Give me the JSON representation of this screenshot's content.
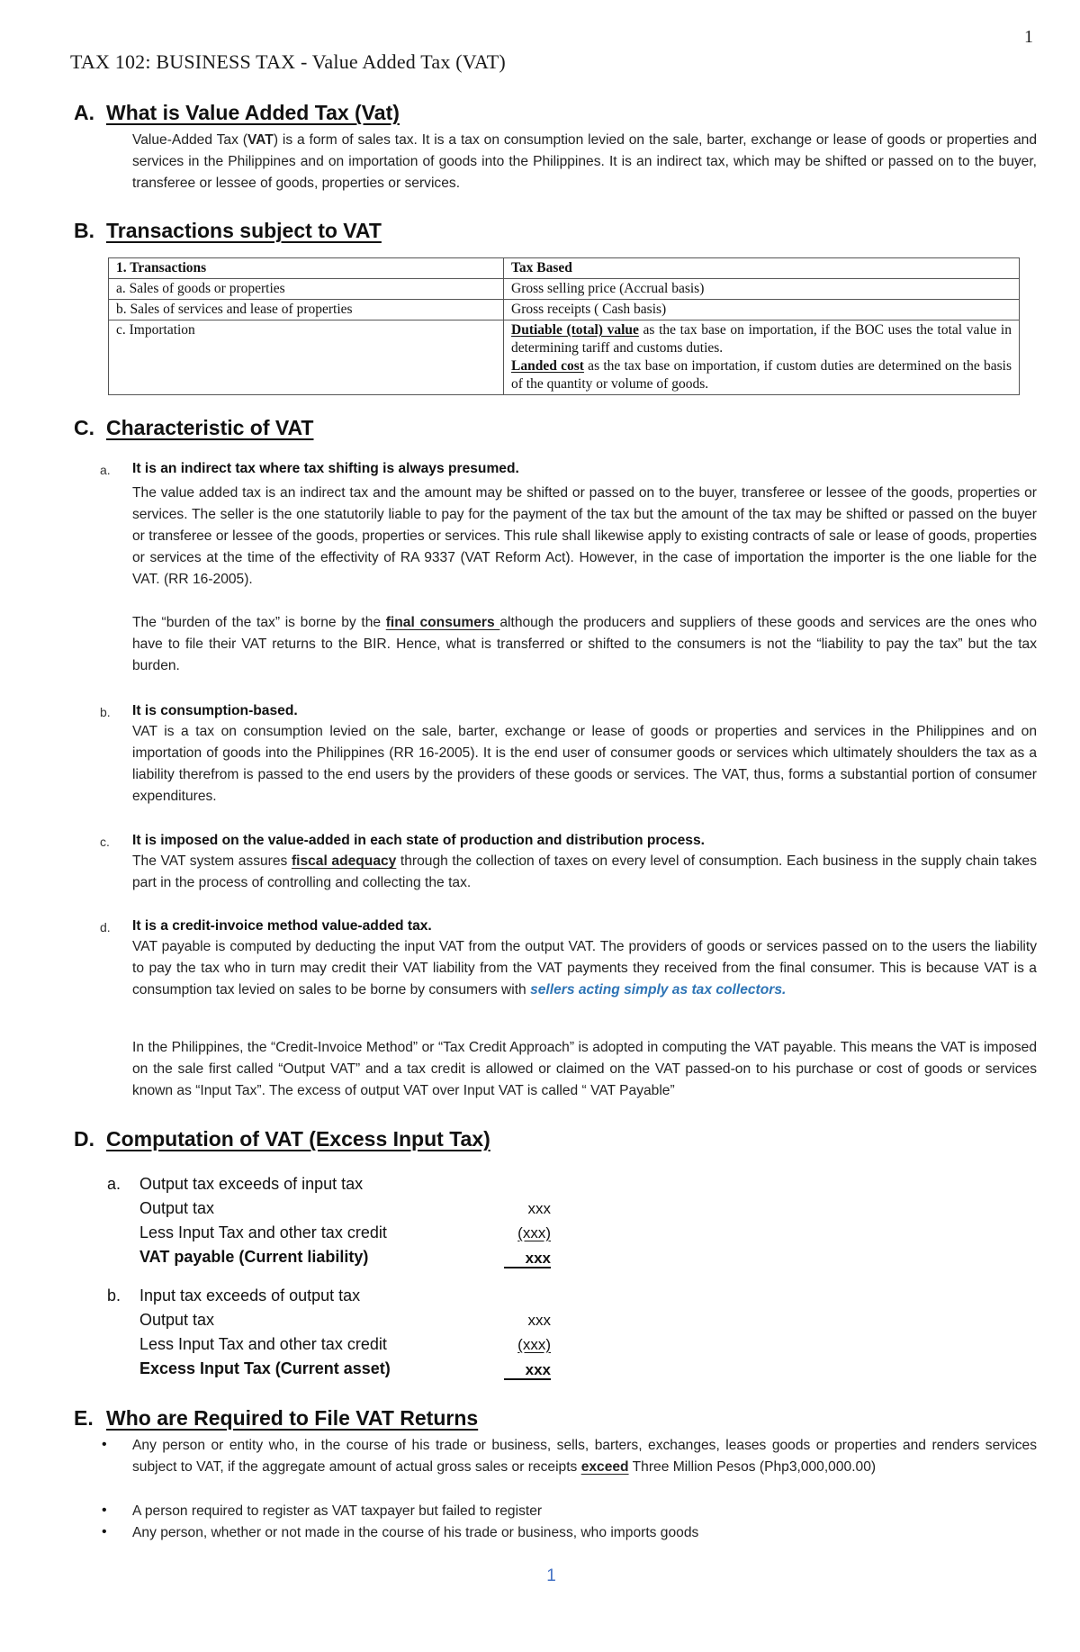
{
  "page_number": "1",
  "header": "TAX 102:  BUSINESS TAX - Value Added Tax (VAT)",
  "sections": {
    "A": {
      "letter": "A.",
      "title": "What is Value Added Tax (Vat)",
      "body_pre": "Value-Added Tax (",
      "body_bold": "VAT",
      "body_post": ") is a form of sales tax. It is a tax on consumption levied on the sale, barter, exchange or lease of goods or properties and services in the Philippines and on importation of goods into the Philippines. It is an indirect tax, which may be shifted or passed on to the buyer, transferee or lessee of goods, properties or services."
    },
    "B": {
      "letter": "B.",
      "title": "Transactions subject to VAT",
      "table": {
        "headers": [
          "1.  Transactions",
          "Tax Based"
        ],
        "rows": [
          {
            "transaction": "a.  Sales of goods or properties",
            "tax_base": "Gross selling price (Accrual basis)"
          },
          {
            "transaction": "b.  Sales of services and lease of properties",
            "tax_base": "Gross receipts ( Cash basis)"
          },
          {
            "transaction": "c.  Importation",
            "tax_base_1_bold": "Dutiable (total) value",
            "tax_base_1_rest": " as the tax base on importation, if the BOC uses the total value in determining tariff and customs duties.",
            "tax_base_2_bold": "Landed cost",
            "tax_base_2_rest": " as the tax base on importation, if custom duties are determined on the basis of the quantity or volume of goods."
          }
        ]
      }
    },
    "C": {
      "letter": "C.",
      "title": "Characteristic of VAT",
      "items": [
        {
          "marker": "a.",
          "heading": "It is an indirect tax where tax shifting is always presumed.",
          "body": "The value added tax is an indirect tax and the amount may be shifted or passed on to the buyer, transferee or lessee of the goods, properties or services. The seller is the one statutorily liable to pay for the payment of the tax but the amount of the tax may be shifted or passed on the buyer or transferee or lessee of the goods, properties or services. This rule shall likewise apply to existing contracts of sale or lease of goods, properties or services at the time of the effectivity of RA 9337 (VAT Reform Act). However, in the case of importation the importer is the one liable for the VAT. (RR 16-2005).",
          "body2_pre": "The “burden of the tax” is borne by the ",
          "body2_bold": "final consumers ",
          "body2_post": "although the producers and suppliers of these goods and services are the ones who have to file their VAT returns to the BIR. Hence, what is transferred or shifted to the consumers is not the “liability to pay the tax” but the tax burden."
        },
        {
          "marker": "b.",
          "heading": "It is consumption-based.",
          "body": "VAT is a tax on consumption levied on the sale, barter, exchange or lease of goods or properties and services in the Philippines and on importation of goods into the Philippines (RR 16-2005). It is the end user of consumer goods or services which ultimately shoulders the tax as a liability therefrom is passed to the end users by the providers of these goods or services. The VAT, thus, forms a substantial portion of consumer expenditures."
        },
        {
          "marker": "c.",
          "heading": "It is imposed on the value-added in each state of production and distribution process.",
          "body_pre": "The VAT system assures ",
          "body_bold": "fiscal adequacy",
          "body_post": " through the collection of taxes on every level of consumption. Each business in the supply chain takes part in the process of controlling and collecting the tax."
        },
        {
          "marker": "d.",
          "heading": "It is a credit-invoice method value-added tax.",
          "body_pre": "VAT payable is computed by deducting the input VAT from the output VAT. The providers of goods or services passed on to the users the liability to pay the tax who in turn may credit their VAT liability from the VAT payments they received from the final consumer. This is because VAT is a consumption tax levied on sales to be borne by consumers with ",
          "body_emph": "sellers acting simply as tax collectors.",
          "body2": "In the Philippines, the “Credit-Invoice Method” or “Tax Credit Approach” is adopted in computing the VAT payable. This means the VAT is imposed on the sale first called “Output VAT” and a tax credit is allowed or claimed on the VAT passed-on to his purchase or cost of goods or services known as “Input Tax”. The excess of output VAT over Input VAT is called “ VAT Payable”"
        }
      ]
    },
    "D": {
      "letter": "D.",
      "title": "Computation of VAT (Excess Input Tax)",
      "cases": [
        {
          "marker": "a.",
          "heading": "Output tax exceeds of input tax",
          "lines": [
            {
              "label": "Output tax",
              "amount": "xxx"
            },
            {
              "label": "Less Input Tax and other tax credit",
              "amount": "(xxx)"
            },
            {
              "label": "VAT payable (Current liability)",
              "amount": "xxx"
            }
          ]
        },
        {
          "marker": "b.",
          "heading": "Input tax exceeds of output tax",
          "lines": [
            {
              "label": "Output tax",
              "amount": "xxx"
            },
            {
              "label": "Less Input Tax and other tax credit",
              "amount": "(xxx)"
            },
            {
              "label": "Excess Input Tax (Current asset)",
              "amount": "xxx"
            }
          ]
        }
      ]
    },
    "E": {
      "letter": "E.",
      "title": "Who are Required to File VAT Returns",
      "bullets": [
        {
          "pre": "Any person or entity who, in the course of his trade or business, sells, barters, exchanges, leases goods or properties and renders services subject to VAT, if the aggregate amount of actual gross sales or receipts ",
          "bold": "exceed",
          "post": " Three Million Pesos (Php3,000,000.00)"
        },
        {
          "text": "A person required to register as VAT taxpayer but failed to register"
        },
        {
          "text": "Any person, whether or not made in the course of his trade or business, who imports goods"
        }
      ],
      "bullet_glyph": "•"
    }
  },
  "footer_page_number": "1",
  "colors": {
    "emphasis_blue": "#2e74b5",
    "footer_blue": "#4472c4"
  }
}
